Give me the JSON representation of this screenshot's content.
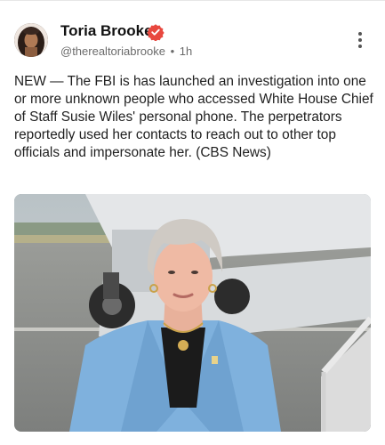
{
  "post": {
    "author_name": "Toria Brooke",
    "handle": "@therealtoriabrooke",
    "separator": "•",
    "time": "1h",
    "text": "NEW — The FBI is has launched an investigation into one or more unknown people who accessed White House Chief of Staff Susie Wiles' personal phone. The perpetrators reportedly used her contacts to reach out to other top officials and impersonate her. (CBS News)"
  },
  "icons": {
    "verified": "verified-badge-icon",
    "more": "more-vertical-icon"
  },
  "colors": {
    "verified_badge": "#e8483f",
    "text_primary": "#1f1f1f",
    "text_secondary": "#6b6b6b",
    "blazer": "#7fb1dd"
  }
}
